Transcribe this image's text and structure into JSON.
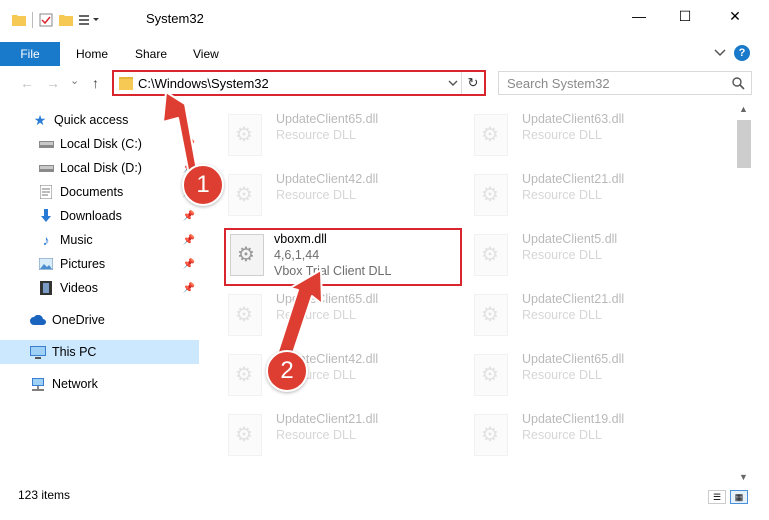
{
  "window": {
    "title": "System32",
    "minimize": "—",
    "maximize": "☐",
    "close": "✕"
  },
  "ribbon": {
    "tabs": [
      "File",
      "Home",
      "Share",
      "View"
    ],
    "expand_icon": "chevron-down-icon",
    "help": "?"
  },
  "nav": {
    "back": "←",
    "forward": "→",
    "recent": "⌄",
    "up": "↑"
  },
  "address": {
    "path": "C:\\Windows\\System32"
  },
  "search": {
    "placeholder": "Search System32"
  },
  "sidebar": {
    "items": [
      {
        "label": "Quick access",
        "icon": "star-icon",
        "pinned": false
      },
      {
        "label": "Local Disk (C:)",
        "icon": "drive-icon",
        "pinned": true
      },
      {
        "label": "Local Disk (D:)",
        "icon": "drive-icon",
        "pinned": true
      },
      {
        "label": "Documents",
        "icon": "documents-icon",
        "pinned": true
      },
      {
        "label": "Downloads",
        "icon": "download-icon",
        "pinned": true
      },
      {
        "label": "Music",
        "icon": "music-icon",
        "pinned": true
      },
      {
        "label": "Pictures",
        "icon": "pictures-icon",
        "pinned": true
      },
      {
        "label": "Videos",
        "icon": "videos-icon",
        "pinned": true
      },
      {
        "label": "OneDrive",
        "icon": "cloud-icon",
        "pinned": false
      },
      {
        "label": "This PC",
        "icon": "computer-icon",
        "pinned": false,
        "selected": true
      },
      {
        "label": "Network",
        "icon": "network-icon",
        "pinned": false
      }
    ]
  },
  "files": {
    "left": [
      {
        "name": "UpdateClient65.dll",
        "type": "Resource DLL"
      },
      {
        "name": "UpdateClient42.dll",
        "type": "Resource DLL"
      },
      {
        "name": "vboxm.dll",
        "version": "4,6,1,44",
        "type": "Vbox Trial Client DLL",
        "highlighted": true
      },
      {
        "name": "UpdateClient65.dll",
        "type": "Resource DLL"
      },
      {
        "name": "UpdateClient42.dll",
        "type": "Resource DLL"
      },
      {
        "name": "UpdateClient21.dll",
        "type": "Resource DLL"
      }
    ],
    "right": [
      {
        "name": "UpdateClient63.dll",
        "type": "Resource DLL"
      },
      {
        "name": "UpdateClient21.dll",
        "type": "Resource DLL"
      },
      {
        "name": "UpdateClient5.dll",
        "type": "Resource DLL"
      },
      {
        "name": "UpdateClient21.dll",
        "type": "Resource DLL"
      },
      {
        "name": "UpdateClient65.dll",
        "type": "Resource DLL"
      },
      {
        "name": "UpdateClient19.dll",
        "type": "Resource DLL"
      }
    ]
  },
  "annotations": {
    "step1": "1",
    "step2": "2",
    "color": "#de3d31"
  },
  "status": {
    "items": "123 items"
  },
  "colors": {
    "accent": "#1979ca",
    "highlight": "#d9262e",
    "selected": "#cce8ff"
  }
}
